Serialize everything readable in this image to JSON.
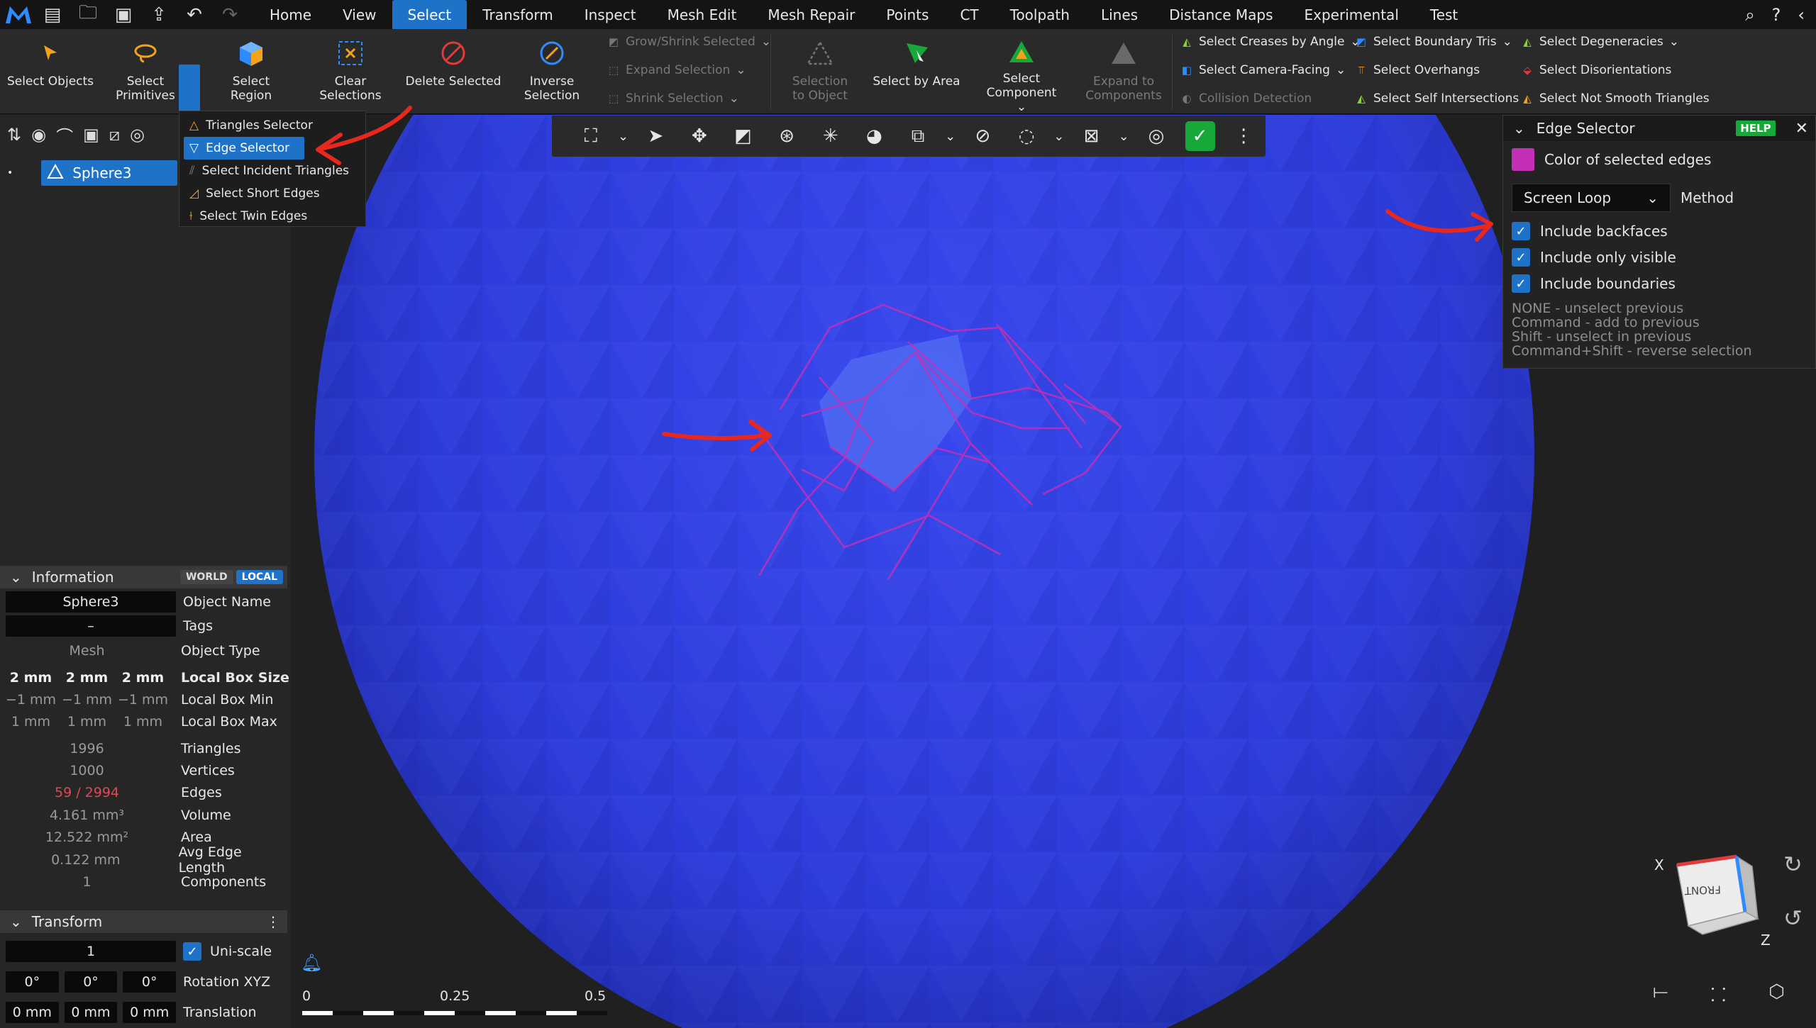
{
  "menubar": {
    "tabs": [
      "Home",
      "View",
      "Select",
      "Transform",
      "Inspect",
      "Mesh Edit",
      "Mesh Repair",
      "Points",
      "CT",
      "Toolpath",
      "Lines",
      "Distance Maps",
      "Experimental",
      "Test"
    ],
    "active_tab": "Select"
  },
  "ribbon": {
    "select_objects": "Select Objects",
    "select_primitives_1": "Select",
    "select_primitives_2": "Primitives",
    "select_region": "Select Region",
    "clear_selections_1": "Clear",
    "clear_selections_2": "Selections",
    "delete_selected": "Delete Selected",
    "inverse_selection_1": "Inverse",
    "inverse_selection_2": "Selection",
    "grow_shrink": "Grow/Shrink Selected",
    "expand_selection": "Expand Selection",
    "shrink_selection": "Shrink Selection",
    "selection_to_object_1": "Selection",
    "selection_to_object_2": "to Object",
    "select_by_area": "Select by Area",
    "select_component_1": "Select",
    "select_component_2": "Component",
    "expand_to_components_1": "Expand to",
    "expand_to_components_2": "Components",
    "select_creases": "Select Creases by Angle",
    "select_camera_facing": "Select Camera-Facing",
    "collision_detection": "Collision Detection",
    "select_boundary_tris": "Select Boundary Tris",
    "select_overhangs": "Select Overhangs",
    "select_self_intersections": "Select Self Intersections",
    "select_degeneracies": "Select Degeneracies",
    "select_disorientations": "Select Disorientations",
    "select_not_smooth": "Select Not Smooth Triangles"
  },
  "dropdown": {
    "items": [
      "Triangles Selector",
      "Edge Selector",
      "Select Incident Triangles",
      "Select Short Edges",
      "Select Twin Edges"
    ]
  },
  "scene": {
    "object": "Sphere3"
  },
  "information": {
    "title": "Information",
    "world": "WORLD",
    "local": "LOCAL",
    "object_name": "Sphere3",
    "object_name_label": "Object Name",
    "tags": "–",
    "tags_label": "Tags",
    "object_type": "Mesh",
    "object_type_label": "Object Type",
    "box_size": [
      "2 mm",
      "2 mm",
      "2 mm"
    ],
    "box_size_label": "Local Box Size",
    "box_min": [
      "−1 mm",
      "−1 mm",
      "−1 mm"
    ],
    "box_min_label": "Local Box Min",
    "box_max": [
      "1 mm",
      "1 mm",
      "1 mm"
    ],
    "box_max_label": "Local Box Max",
    "triangles": "1996",
    "triangles_label": "Triangles",
    "vertices": "1000",
    "vertices_label": "Vertices",
    "edges": "59 / 2994",
    "edges_label": "Edges",
    "volume": "4.161 mm³",
    "volume_label": "Volume",
    "area": "12.522 mm²",
    "area_label": "Area",
    "avg_edge": "0.122 mm",
    "avg_edge_label": "Avg Edge Length",
    "components": "1",
    "components_label": "Components"
  },
  "transform": {
    "title": "Transform",
    "uniscale_value": "1",
    "uniscale_label": "Uni-scale",
    "rotation": [
      "0°",
      "0°",
      "0°"
    ],
    "rotation_label": "Rotation XYZ",
    "translation": [
      "0 mm",
      "0 mm",
      "0 mm"
    ],
    "translation_label": "Translation"
  },
  "edge_selector": {
    "title": "Edge Selector",
    "help": "HELP",
    "color_label": "Color of selected edges",
    "color": "#c42fb8",
    "method_value": "Screen Loop",
    "method_label": "Method",
    "include_backfaces": "Include backfaces",
    "include_only_visible": "Include only visible",
    "include_boundaries": "Include boundaries",
    "help_lines": [
      "NONE - unselect previous",
      "Command - add to previous",
      "Shift - unselect in previous",
      "Command+Shift - reverse selection"
    ]
  },
  "ruler": {
    "ticks": [
      "0",
      "0.25",
      "0.5"
    ]
  },
  "viewcube": {
    "x": "X",
    "z": "Z",
    "face": "FRONT"
  },
  "colors": {
    "accent": "#1e73c8",
    "sphere": "#2f3fe0",
    "selection": "#c42fb8",
    "arrow": "#e8271d"
  }
}
